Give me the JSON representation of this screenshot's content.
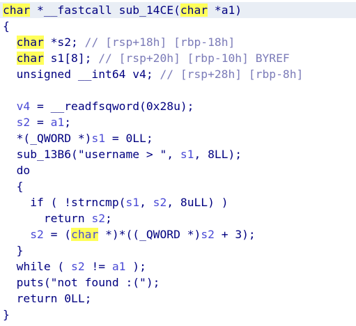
{
  "pseudocode": {
    "lines": [
      {
        "segments": [
          {
            "text": "char",
            "kind": "hl"
          },
          {
            "text": " *__fastcall sub_14CE(",
            "kind": "t"
          },
          {
            "text": "char",
            "kind": "hl"
          },
          {
            "text": " *a1)",
            "kind": "t"
          }
        ]
      },
      {
        "segments": [
          {
            "text": "{",
            "kind": "t"
          }
        ]
      },
      {
        "segments": [
          {
            "text": "  ",
            "kind": "t"
          },
          {
            "text": "char",
            "kind": "hl"
          },
          {
            "text": " *s2; ",
            "kind": "t"
          },
          {
            "text": "// [rsp+18h] [rbp-18h]",
            "kind": "c"
          }
        ]
      },
      {
        "segments": [
          {
            "text": "  ",
            "kind": "t"
          },
          {
            "text": "char",
            "kind": "hl"
          },
          {
            "text": " s1[8]; ",
            "kind": "t"
          },
          {
            "text": "// [rsp+20h] [rbp-10h] BYREF",
            "kind": "c"
          }
        ]
      },
      {
        "segments": [
          {
            "text": "  unsigned __int64 v4; ",
            "kind": "t"
          },
          {
            "text": "// [rsp+28h] [rbp-8h]",
            "kind": "c"
          }
        ]
      },
      {
        "segments": [
          {
            "text": "",
            "kind": "t"
          }
        ]
      },
      {
        "segments": [
          {
            "text": "  ",
            "kind": "t"
          },
          {
            "text": "v4",
            "kind": "hl-var"
          },
          {
            "text": " = __readfsqword(",
            "kind": "t"
          },
          {
            "text": "0x28u",
            "kind": "t"
          },
          {
            "text": ");",
            "kind": "t"
          }
        ]
      },
      {
        "segments": [
          {
            "text": "  ",
            "kind": "t"
          },
          {
            "text": "s2",
            "kind": "hl-var"
          },
          {
            "text": " = ",
            "kind": "t"
          },
          {
            "text": "a1",
            "kind": "hl-var"
          },
          {
            "text": ";",
            "kind": "t"
          }
        ]
      },
      {
        "segments": [
          {
            "text": "  *(_QWORD *)",
            "kind": "t"
          },
          {
            "text": "s1",
            "kind": "hl-var"
          },
          {
            "text": " = 0LL;",
            "kind": "t"
          }
        ]
      },
      {
        "segments": [
          {
            "text": "  sub_13B6(\"username > \", ",
            "kind": "t"
          },
          {
            "text": "s1",
            "kind": "hl-var"
          },
          {
            "text": ", 8LL);",
            "kind": "t"
          }
        ]
      },
      {
        "segments": [
          {
            "text": "  do",
            "kind": "t"
          }
        ]
      },
      {
        "segments": [
          {
            "text": "  {",
            "kind": "t"
          }
        ]
      },
      {
        "segments": [
          {
            "text": "    if ( !strncmp(",
            "kind": "t"
          },
          {
            "text": "s1",
            "kind": "hl-var"
          },
          {
            "text": ", ",
            "kind": "t"
          },
          {
            "text": "s2",
            "kind": "hl-var"
          },
          {
            "text": ", 8uLL) )",
            "kind": "t"
          }
        ]
      },
      {
        "segments": [
          {
            "text": "      return ",
            "kind": "t"
          },
          {
            "text": "s2",
            "kind": "hl-var"
          },
          {
            "text": ";",
            "kind": "t"
          }
        ]
      },
      {
        "segments": [
          {
            "text": "    ",
            "kind": "t"
          },
          {
            "text": "s2",
            "kind": "hl-var"
          },
          {
            "text": " = (",
            "kind": "t"
          },
          {
            "text": "char",
            "kind": "hl-kw"
          },
          {
            "text": " *)*((_QWORD *)",
            "kind": "t"
          },
          {
            "text": "s2",
            "kind": "hl-var"
          },
          {
            "text": " + 3);",
            "kind": "t"
          }
        ]
      },
      {
        "segments": [
          {
            "text": "  }",
            "kind": "t"
          }
        ]
      },
      {
        "segments": [
          {
            "text": "  while ( ",
            "kind": "t"
          },
          {
            "text": "s2",
            "kind": "hl-var"
          },
          {
            "text": " != ",
            "kind": "t"
          },
          {
            "text": "a1",
            "kind": "hl-var"
          },
          {
            "text": " );",
            "kind": "t"
          }
        ]
      },
      {
        "segments": [
          {
            "text": "  puts(\"not found :(\");",
            "kind": "t"
          }
        ]
      },
      {
        "segments": [
          {
            "text": "  return 0LL;",
            "kind": "t"
          }
        ]
      },
      {
        "segments": [
          {
            "text": "}",
            "kind": "t"
          }
        ]
      }
    ]
  },
  "colors": {
    "text": "#000080",
    "comment": "#7b7bb8",
    "variable": "#4a4ad6",
    "highlight": "#ffff5a",
    "current_line": "#e9eef5"
  }
}
